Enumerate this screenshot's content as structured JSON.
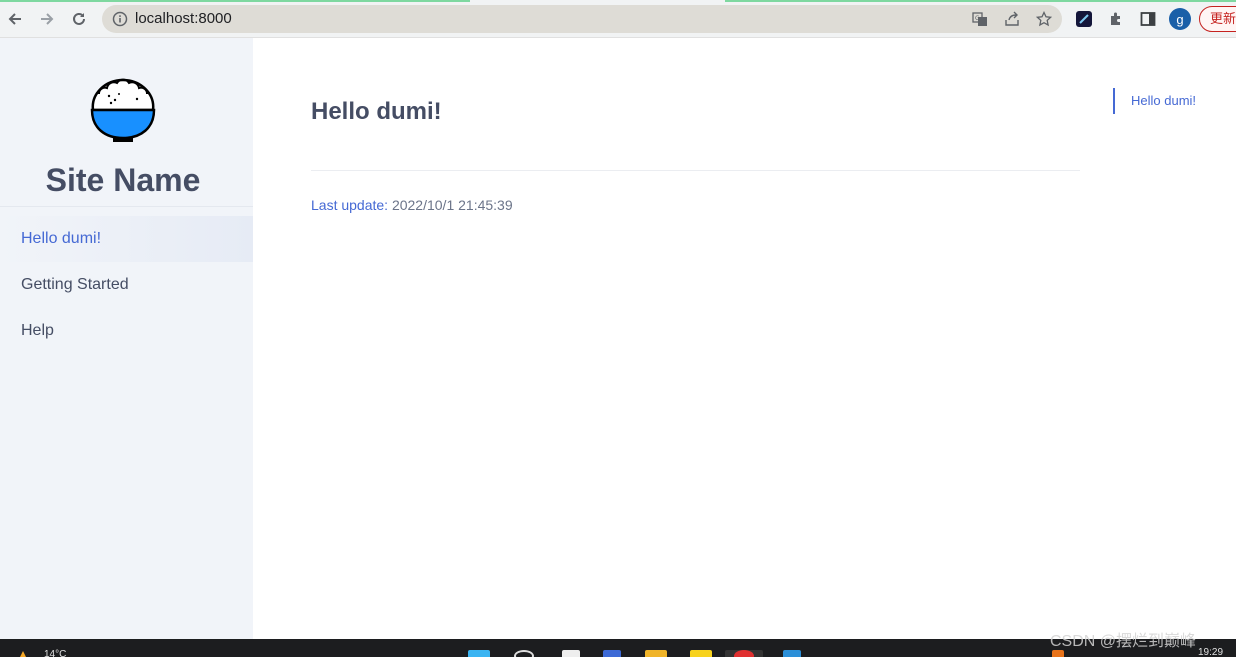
{
  "browser": {
    "url": "localhost:8000",
    "avatar_letter": "g",
    "update_label": "更新"
  },
  "icons": {
    "back": "arrow-left-icon",
    "forward": "arrow-right-icon",
    "reload": "reload-icon",
    "info": "info-icon",
    "translate": "translate-icon",
    "share": "share-icon",
    "bookmark": "star-icon",
    "extension": "puzzle-icon",
    "side_panel": "side-panel-icon",
    "logo": "rice-bowl-icon"
  },
  "colors": {
    "accent": "#4569d4",
    "sidebar_bg": "#f1f4f9",
    "text": "#454d64",
    "logo_blue": "#1890ff"
  },
  "sidebar": {
    "site_name": "Site Name",
    "items": [
      {
        "label": "Hello dumi!",
        "active": true
      },
      {
        "label": "Getting Started",
        "active": false
      },
      {
        "label": "Help",
        "active": false
      }
    ]
  },
  "main": {
    "title": "Hello dumi!",
    "last_update_label": "Last update:",
    "last_update_value": "2022/10/1 21:45:39"
  },
  "toc": {
    "items": [
      "Hello dumi!"
    ]
  },
  "taskbar": {
    "weather": "14°C",
    "time": "19:29"
  },
  "watermark": "CSDN @摆烂到巅峰"
}
